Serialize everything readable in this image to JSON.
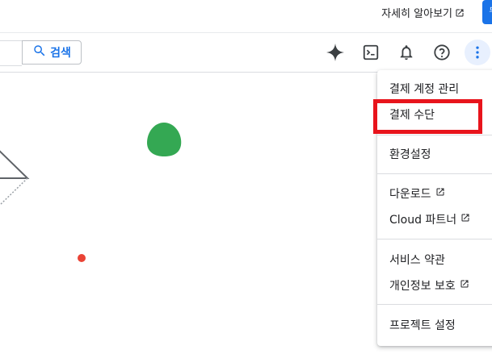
{
  "banner": {
    "learn_more_label": "자세히 알아보기",
    "external_icon": "open-in-new-icon",
    "button_label": "무"
  },
  "toolbar": {
    "search_label": "검색",
    "search_icon": "search-icon",
    "icons": [
      "gemini-spark-icon",
      "cloud-shell-icon",
      "notifications-bell-icon",
      "help-icon",
      "more-vert-icon"
    ]
  },
  "menu": {
    "items": [
      {
        "label": "결제 계정 관리",
        "external": false
      },
      {
        "label": "결제 수단",
        "external": false,
        "highlighted": true
      },
      {
        "label": "환경설정",
        "external": false
      },
      {
        "label": "다운로드",
        "external": true
      },
      {
        "label": "Cloud 파트너",
        "external": true
      },
      {
        "label": "서비스 약관",
        "external": false
      },
      {
        "label": "개인정보 보호",
        "external": true
      },
      {
        "label": "프로젝트 설정",
        "external": false
      }
    ]
  },
  "colors": {
    "accent": "#1a73e8",
    "highlight": "#e8141c",
    "green_blob": "#34a853",
    "red_dot": "#ea4335"
  }
}
